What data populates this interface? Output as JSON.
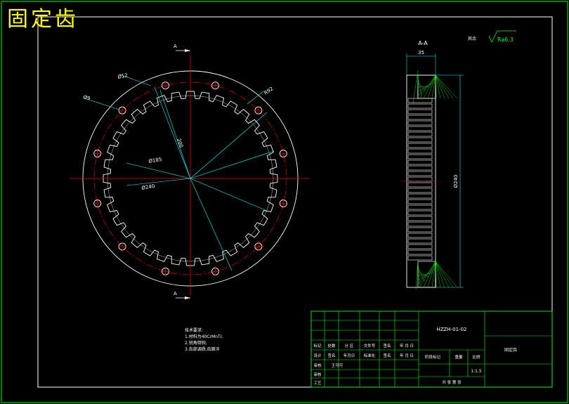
{
  "title": "固定齿",
  "roughness": {
    "label": "其余",
    "value": "Ra6.3"
  },
  "section": {
    "label": "A-A",
    "cut_marker": "A",
    "width_dim": "35",
    "height_dim": "Ø240"
  },
  "front_view": {
    "dims": {
      "d12": "Ø12",
      "d9": "Ø9",
      "r92": "R92",
      "r100": "200",
      "d185": "Ø185",
      "d240": "Ø240"
    },
    "bolt_holes": 12,
    "teeth": 36
  },
  "notes": {
    "heading": "技术要求:",
    "lines": [
      "1.材料为40CrMnTi;",
      "2.锐角倒钝;",
      "3.齿部调质,齿面淬"
    ]
  },
  "title_block": {
    "drawing_no": "HZZH-01-02",
    "part_name": "固定齿",
    "row1": [
      "标记",
      "处数",
      "分  区",
      "文件号",
      "签名",
      "年 月 日"
    ],
    "row2": [
      "设计",
      "签名",
      "年月日",
      "标准化",
      "签名",
      "年 月 日"
    ],
    "stage_label": "阶段标记",
    "weight_label": "重量",
    "scale_label": "比例",
    "scale_value": "1:1.5",
    "check_label": "审核",
    "review_label": "审核",
    "designer": "王可可",
    "process_label": "工艺",
    "sheets": "共   张  第   张"
  }
}
